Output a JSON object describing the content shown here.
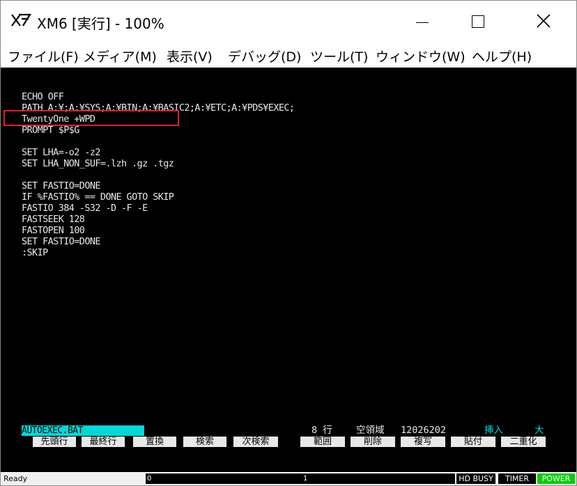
{
  "window": {
    "title": "XM6 [実行] - 100%"
  },
  "menu": [
    {
      "label": "ファイル(F)"
    },
    {
      "label": "メディア(M)"
    },
    {
      "label": "表示(V)"
    },
    {
      "label": "デバッグ(D)"
    },
    {
      "label": "ツール(T)"
    },
    {
      "label": "ウィンドウ(W)"
    },
    {
      "label": "ヘルプ(H)"
    }
  ],
  "editor": {
    "lines": [
      "ECHO OFF",
      "PATH A:¥;A:¥SYS;A:¥BIN;A:¥BASIC2;A:¥ETC;A:¥PDS¥EXEC;",
      "TwentyOne +WPD",
      "PROMPT $P$G",
      "",
      "SET LHA=-o2 -z2",
      "SET LHA_NON_SUF=.lzh .gz .tgz",
      "",
      "SET FASTIO=DONE",
      "IF %FASTIO% == DONE GOTO SKIP",
      "FASTIO 384 -S32 -D -F -E",
      "FASTSEEK 128",
      "FASTOPEN 100",
      "SET FASTIO=DONE",
      ":SKIP"
    ],
    "status": {
      "filename": "AUTOEXEC.BAT",
      "line": "8 行",
      "free_label": "空領域",
      "free_value": "12026202",
      "mode": "挿入",
      "size": "大"
    },
    "fkeys": [
      {
        "label": "先頭行"
      },
      {
        "label": "最終行"
      },
      {
        "label": "置換"
      },
      {
        "label": "検索"
      },
      {
        "label": "次検索"
      },
      {
        "label": "範囲"
      },
      {
        "label": "削除"
      },
      {
        "label": "複写"
      },
      {
        "label": "貼付"
      },
      {
        "label": "二重化"
      }
    ]
  },
  "statusbar": {
    "ready": "Ready",
    "pane0": "0",
    "pane1": "1",
    "hd_busy": "HD BUSY",
    "timer": "TIMER",
    "power": "POWER"
  },
  "colors": {
    "highlight": "#e0202a",
    "cyan": "#00d8d8",
    "power": "#00d000"
  }
}
